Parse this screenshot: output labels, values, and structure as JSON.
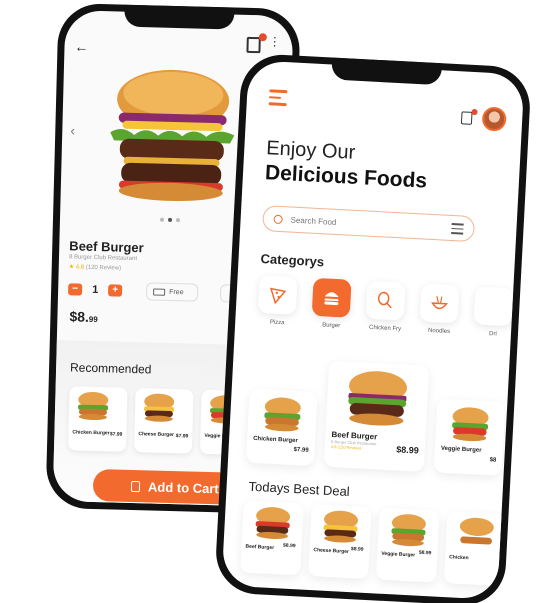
{
  "left": {
    "product": {
      "title": "Beef Burger",
      "restaurant": "8 Burger Club Restaurant",
      "rating_value": "★ 4.8",
      "rating_reviews": "(120 Review)",
      "qty": "1",
      "minus_label": "−",
      "plus_label": "+",
      "delivery": "Free",
      "price_main": "$8.",
      "price_cents": "99"
    },
    "recommended": {
      "title": "Recommended",
      "items": [
        {
          "name": "Chicken Burger",
          "price": "$7.99"
        },
        {
          "name": "Cheese Burger",
          "price": "$7.99"
        },
        {
          "name": "Veggie Burg",
          "price": ""
        }
      ]
    },
    "add_to_cart": "Add to Cart"
  },
  "right": {
    "greeting": "Enjoy Our",
    "headline": "Delicious Foods",
    "search_placeholder": "Search Food",
    "categories_title": "Categorys",
    "categories": [
      {
        "label": "Pizza",
        "active": false
      },
      {
        "label": "Burger",
        "active": true
      },
      {
        "label": "Chicken Fry",
        "active": false
      },
      {
        "label": "Noodles",
        "active": false
      },
      {
        "label": "Dri",
        "active": false
      }
    ],
    "popular": [
      {
        "name": "Chicken Burger",
        "price": "$7.99"
      },
      {
        "name": "Beef Burger",
        "sub": "8 Burger Club Restaurant",
        "rating": "4.8 (120 Review)",
        "price": "$8.99"
      },
      {
        "name": "Veggie Burger",
        "price": "$8"
      }
    ],
    "best_deal_title": "Todays Best Deal",
    "best": [
      {
        "name": "Beef Burger",
        "price": "$8.99"
      },
      {
        "name": "Cheese Burger",
        "price": "$8.99"
      },
      {
        "name": "Veggie Burger",
        "price": "$8.99"
      },
      {
        "name": "Chicken",
        "price": ""
      }
    ]
  },
  "colors": {
    "accent": "#f26a2e",
    "text": "#222222",
    "star": "#f0b400"
  }
}
